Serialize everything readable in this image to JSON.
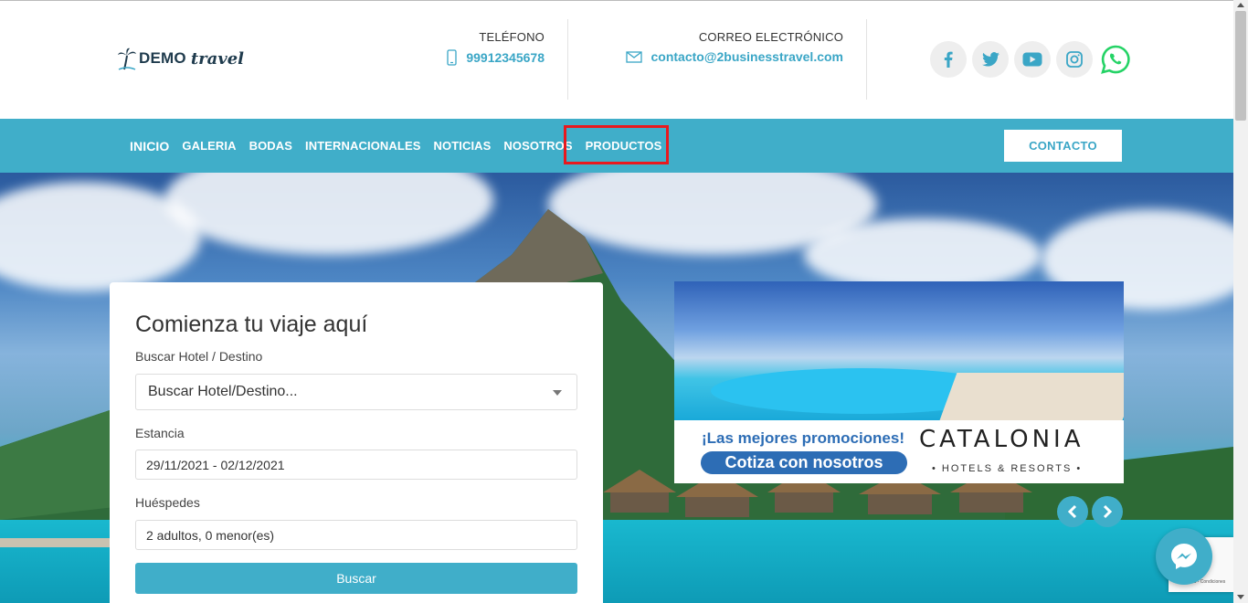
{
  "brand": {
    "logo_demo": "DEMO",
    "logo_travel": "travel"
  },
  "header": {
    "phone_label": "TELÉFONO",
    "phone_value": "99912345678",
    "email_label": "CORREO ELECTRÓNICO",
    "email_value": "contacto@2businesstravel.com"
  },
  "socials": [
    {
      "icon": "facebook-icon"
    },
    {
      "icon": "twitter-icon"
    },
    {
      "icon": "youtube-icon"
    },
    {
      "icon": "instagram-icon"
    },
    {
      "icon": "whatsapp-icon"
    }
  ],
  "nav": {
    "items": [
      "INICIO",
      "GALERIA",
      "BODAS",
      "INTERNACIONALES",
      "NOTICIAS",
      "NOSOTROS",
      "PRODUCTOS"
    ],
    "contact_button": "CONTACTO",
    "highlighted": "PRODUCTOS"
  },
  "search_form": {
    "title": "Comienza tu viaje aquí",
    "destination_label": "Buscar Hotel / Destino",
    "destination_value": "Buscar Hotel/Destino...",
    "stay_label": "Estancia",
    "stay_value": "29/11/2021 - 02/12/2021",
    "guests_label": "Huéspedes",
    "guests_value": "2 adultos, 0 menor(es)",
    "submit_label": "Buscar"
  },
  "promo": {
    "headline": "¡Las mejores promociones!",
    "cta": "Cotiza con nosotros",
    "brand": "CATALONIA",
    "brand_sub": "• HOTELS & RESORTS •"
  },
  "recaptcha": {
    "text": "Privacidad - Condiciones"
  },
  "colors": {
    "primary": "#40aec9",
    "highlight_border": "#e8191e",
    "promo_blue": "#2d6db5",
    "whatsapp": "#25d366"
  }
}
